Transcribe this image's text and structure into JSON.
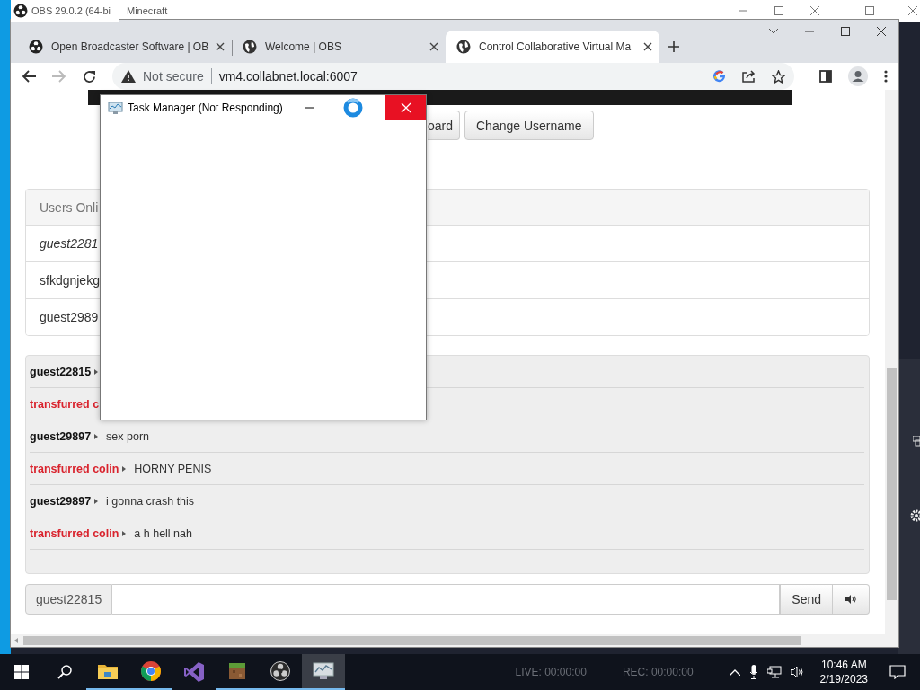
{
  "background_windows": [
    {
      "title": "OBS 29.0.2 (64-bi"
    },
    {
      "title": "Minecraft"
    }
  ],
  "browser": {
    "tabs": [
      {
        "title": "Open Broadcaster Software | OB",
        "kind": "obs",
        "selected": false
      },
      {
        "title": "Welcome | OBS",
        "kind": "globe",
        "selected": false
      },
      {
        "title": "Control Collaborative Virtual Ma",
        "kind": "globe",
        "selected": true
      }
    ],
    "address": {
      "security": "Not secure",
      "url": "vm4.collabnet.local:6007"
    }
  },
  "page": {
    "buttons": [
      "oard",
      "Change Username"
    ],
    "users_panel": {
      "title": "Users Onli",
      "users": [
        {
          "name": "guest2281",
          "self": true
        },
        {
          "name": "sfkdgnjekg",
          "self": false
        },
        {
          "name": "guest2989",
          "self": false
        }
      ]
    },
    "chat": [
      {
        "name": "guest22815",
        "color": "#111111",
        "marker": true
      },
      {
        "name": "transfurred c",
        "color": "#d9232d"
      },
      {
        "name": "guest29897",
        "color": "#111111",
        "marker": true,
        "text": "sex porn"
      },
      {
        "name": "transfurred colin",
        "color": "#d9232d",
        "marker": true,
        "text": "HORNY PENIS"
      },
      {
        "name": "guest29897",
        "color": "#111111",
        "marker": true,
        "text": "i gonna crash this"
      },
      {
        "name": "transfurred colin",
        "color": "#d9232d",
        "marker": true,
        "text": "a h hell nah"
      }
    ],
    "composer": {
      "username": "guest22815",
      "send": "Send"
    }
  },
  "task_manager": {
    "title": "Task Manager (Not Responding)"
  },
  "taskbar": {
    "apps": [
      {
        "kind": "explorer",
        "running": true,
        "active": false
      },
      {
        "kind": "chrome",
        "running": true,
        "active": false
      },
      {
        "kind": "vs",
        "running": false,
        "active": false
      },
      {
        "kind": "minecraft",
        "running": true,
        "active": false
      },
      {
        "kind": "obs",
        "running": true,
        "active": false
      },
      {
        "kind": "taskmgr",
        "running": true,
        "active": true
      }
    ],
    "indicators": [
      "LIVE: 00:00:00",
      "REC: 00:00:00"
    ],
    "time": "10:46 AM",
    "date": "2/19/2023"
  }
}
